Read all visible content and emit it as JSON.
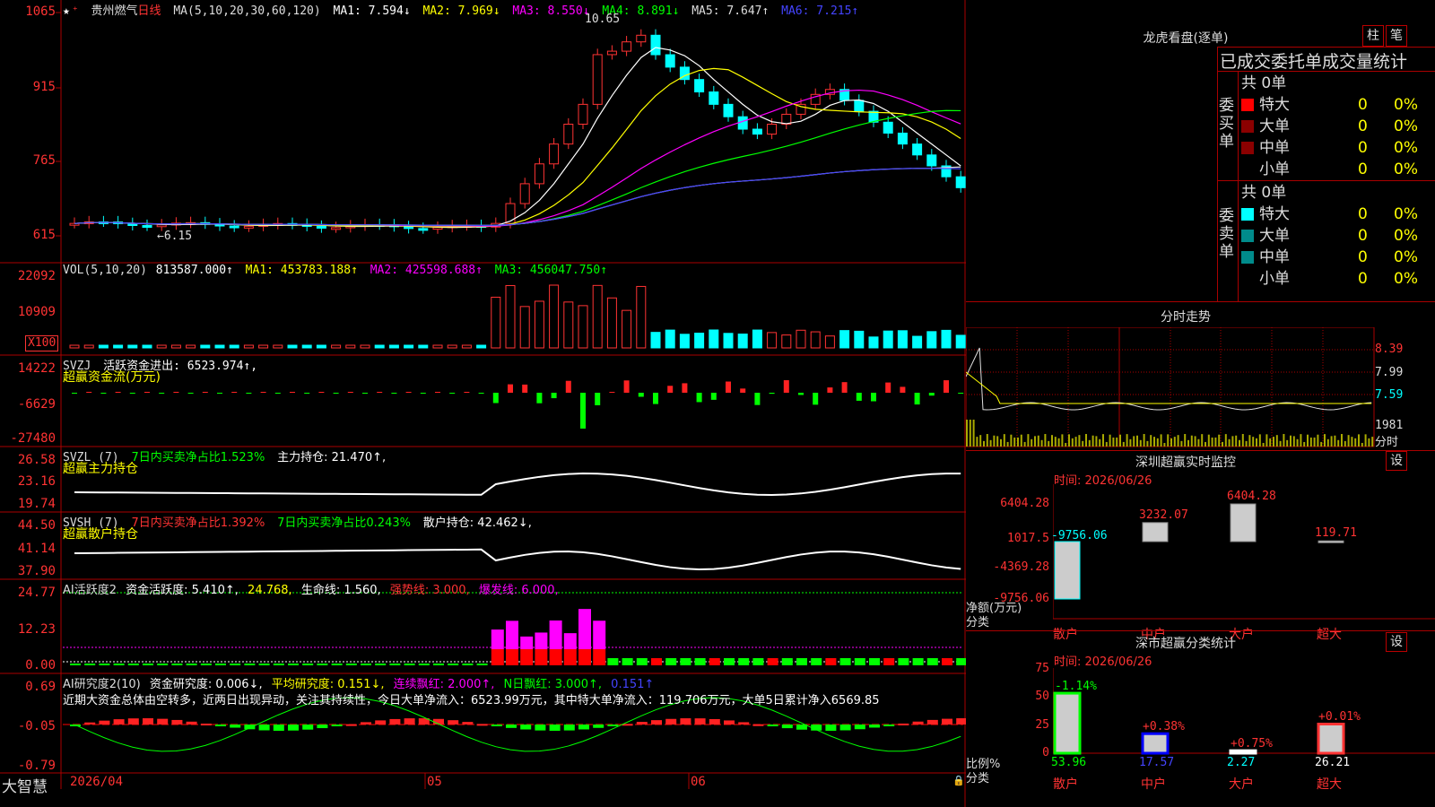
{
  "colors": {
    "up": "#ff3333",
    "down": "#00ffff",
    "bg": "#000000",
    "frame": "#aa0000",
    "green": "#00ff00",
    "yellow": "#ffff00",
    "magenta": "#ff00ff",
    "white": "#ffffff"
  },
  "main": {
    "stock_name": "贵州燃气",
    "period": "日线",
    "ma_label": "MA(5,10,20,30,60,120)",
    "ma1": "MA1: 7.594↓",
    "ma2": "MA2: 7.969↓",
    "ma3": "MA3: 8.550↓",
    "ma4": "MA4: 8.891↓",
    "ma5": "MA5: 7.647↑",
    "ma6": "MA6: 7.215↑",
    "high_mark": "10.65",
    "low_mark": "←6.15",
    "y_ticks": [
      "1065",
      "915",
      "765",
      "615"
    ]
  },
  "vol": {
    "title": "VOL(5,10,20)",
    "v": "813587.000↑",
    "ma1": "MA1: 453783.188↑",
    "ma2": "MA2: 425598.688↑",
    "ma3": "MA3: 456047.750↑",
    "y_ticks": [
      "22092",
      "10909"
    ],
    "unit": "X100"
  },
  "svzj": {
    "title": "SVZJ",
    "sub": "活跃资金进出: 6523.974↑,",
    "label": "超赢资金流(万元)",
    "y_ticks": [
      "14222",
      "-6629",
      "-27480"
    ]
  },
  "svzl": {
    "title": "SVZL (7)",
    "sub1": "7日内买卖净占比1.523%",
    "sub2": "主力持仓: 21.470↑,",
    "label": "超赢主力持仓",
    "y_ticks": [
      "26.58",
      "23.16",
      "19.74"
    ]
  },
  "svsh": {
    "title": "SVSH (7)",
    "sub1": "7日内买卖净占比1.392%",
    "sub2": "7日内买卖净占比0.243%",
    "sub3": "散户持仓: 42.462↓,",
    "label": "超赢散户持仓",
    "y_ticks": [
      "44.50",
      "41.14",
      "37.90"
    ]
  },
  "ai1": {
    "title": "AI活跃度2",
    "sub1": "资金活跃度: 5.410↑,",
    "sub2": "24.768,",
    "sub3": "生命线: 1.560,",
    "sub4": "强势线: 3.000,",
    "sub5": "爆发线: 6.000,",
    "y_ticks": [
      "24.77",
      "12.23",
      "0.00"
    ]
  },
  "ai2": {
    "title": "AI研究度2(10)",
    "sub1": "资金研究度: 0.006↓,",
    "sub2": "平均研究度: 0.151↓,",
    "sub3": "连续飘红: 2.000↑,",
    "sub4": "N日飘红: 3.000↑,",
    "sub5": "0.151↑",
    "desc": "近期大资金总体由空转多，近两日出现异动，关注其持续性，今日大单净流入：6523.99万元，其中特大单净流入：119.706万元，大单5日累计净入6569.85",
    "y_ticks": [
      "0.69",
      "-0.05",
      "-0.79"
    ]
  },
  "xaxis": {
    "labels": [
      "2026/04",
      "05",
      "06"
    ],
    "brand": "大智慧"
  },
  "longhu": {
    "title": "龙虎看盘(逐单)",
    "btn1": "柱",
    "btn2": "笔",
    "header": "已成交委托单成交量统计",
    "buy": {
      "side": "委买单",
      "total": "共 0单",
      "rows": [
        {
          "name": "特大",
          "v": "0",
          "p": "0%"
        },
        {
          "name": "大单",
          "v": "0",
          "p": "0%"
        },
        {
          "name": "中单",
          "v": "0",
          "p": "0%"
        },
        {
          "name": "小单",
          "v": "0",
          "p": "0%"
        }
      ]
    },
    "sell": {
      "side": "委卖单",
      "total": "共 0单",
      "rows": [
        {
          "name": "特大",
          "v": "0",
          "p": "0%"
        },
        {
          "name": "大单",
          "v": "0",
          "p": "0%"
        },
        {
          "name": "中单",
          "v": "0",
          "p": "0%"
        },
        {
          "name": "小单",
          "v": "0",
          "p": "0%"
        }
      ]
    }
  },
  "fenshi": {
    "title": "分时走势",
    "y_ticks": [
      "8.39",
      "7.99",
      "7.59"
    ],
    "vol": "1981",
    "unit": "分时"
  },
  "monitor": {
    "title": "深圳超赢实时监控",
    "btn": "设",
    "time": "时间: 2026/06/26",
    "y_ticks": [
      "6404.28",
      "1017.5",
      "-4369.28",
      "-9756.06"
    ],
    "ylabel": "净额(万元)",
    "xlabel": "分类",
    "values": [
      {
        "cat": "散户",
        "v": -9756.06,
        "label": "-9756.06"
      },
      {
        "cat": "中户",
        "v": 3232.07,
        "label": "3232.07"
      },
      {
        "cat": "大户",
        "v": 6404.28,
        "label": "6404.28"
      },
      {
        "cat": "超大",
        "v": 119.71,
        "label": "119.71"
      }
    ]
  },
  "classify": {
    "title": "深市超赢分类统计",
    "btn": "设",
    "time": "时间: 2026/06/26",
    "y_ticks": [
      "75",
      "50",
      "25",
      "0"
    ],
    "ylabel": "比例%",
    "xlabel": "分类",
    "values": [
      {
        "cat": "散户",
        "v": 53.96,
        "label": "53.96",
        "chg": "-1.14%"
      },
      {
        "cat": "中户",
        "v": 17.57,
        "label": "17.57",
        "chg": "+0.38%"
      },
      {
        "cat": "大户",
        "v": 2.27,
        "label": "2.27",
        "chg": "+0.75%"
      },
      {
        "cat": "超大",
        "v": 26.21,
        "label": "26.21",
        "chg": "+0.01%"
      }
    ]
  }
}
